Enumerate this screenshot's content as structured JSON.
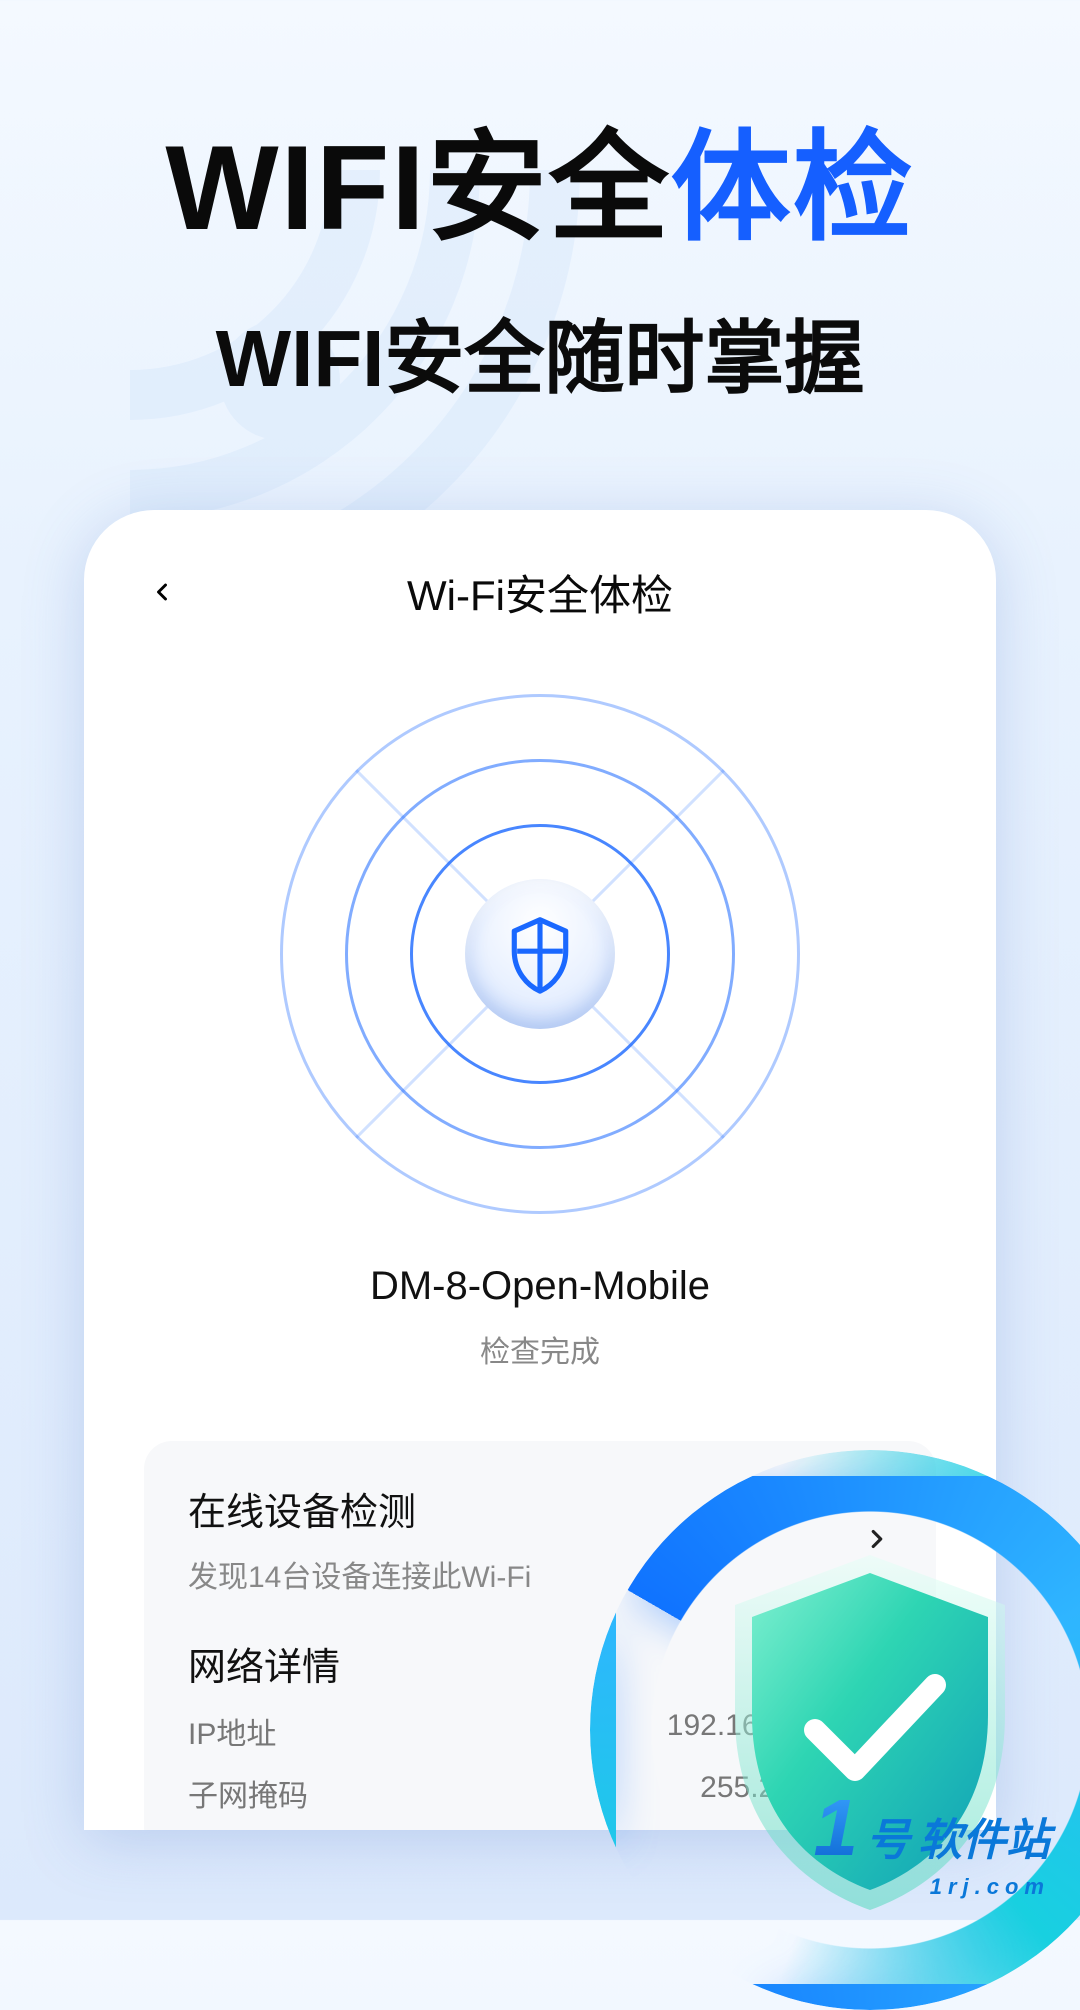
{
  "hero": {
    "title_part1": "WIFI安全",
    "title_part2": "体检",
    "subtitle": "WIFI安全随时掌握"
  },
  "phone": {
    "back_icon": "back-icon",
    "title": "Wi-Fi安全体检",
    "network_name": "DM-8-Open-Mobile",
    "check_status": "检查完成",
    "device_card": {
      "title": "在线设备检测",
      "subtitle": "发现14台设备连接此Wi-Fi"
    },
    "network_detail": {
      "title": "网络详情",
      "rows": [
        {
          "label": "IP地址",
          "value": "192.168.124.146"
        },
        {
          "label": "子网掩码",
          "value": "255.255.255.0"
        }
      ]
    }
  },
  "watermark": {
    "num": "1",
    "suffix": "号",
    "label": "软件站",
    "domain": "1rj.com"
  }
}
